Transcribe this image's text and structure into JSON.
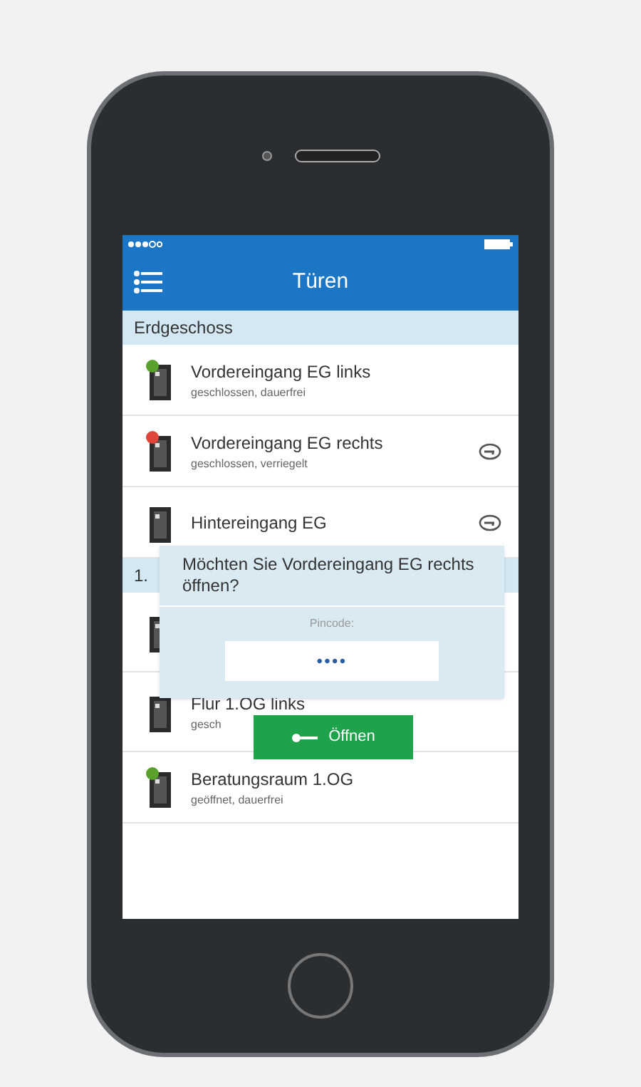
{
  "header": {
    "title": "Türen"
  },
  "sections": [
    {
      "title": "Erdgeschoss",
      "items": [
        {
          "name": "Vordereingang EG links",
          "status": "geschlossen, dauerfrei",
          "color": "#5aa02c",
          "key": false
        },
        {
          "name": "Vordereingang EG rechts",
          "status": "geschlossen, verriegelt",
          "color": "#e0443a",
          "key": true
        },
        {
          "name": "Hintereingang EG",
          "key": true
        }
      ]
    },
    {
      "title": "1.",
      "items": [
        {
          "key": false
        },
        {
          "name": "Flur 1.OG links",
          "status": "gesch",
          "key": false
        },
        {
          "name": "Beratungsraum 1.OG",
          "status": "geöffnet, dauerfrei",
          "color": "#5aa02c",
          "key": false
        }
      ]
    }
  ],
  "dialog": {
    "question": "Möchten Sie Vordereingang EG rechts öffnen?",
    "label": "Pincode:",
    "value": "••••",
    "button": "Öffnen"
  }
}
